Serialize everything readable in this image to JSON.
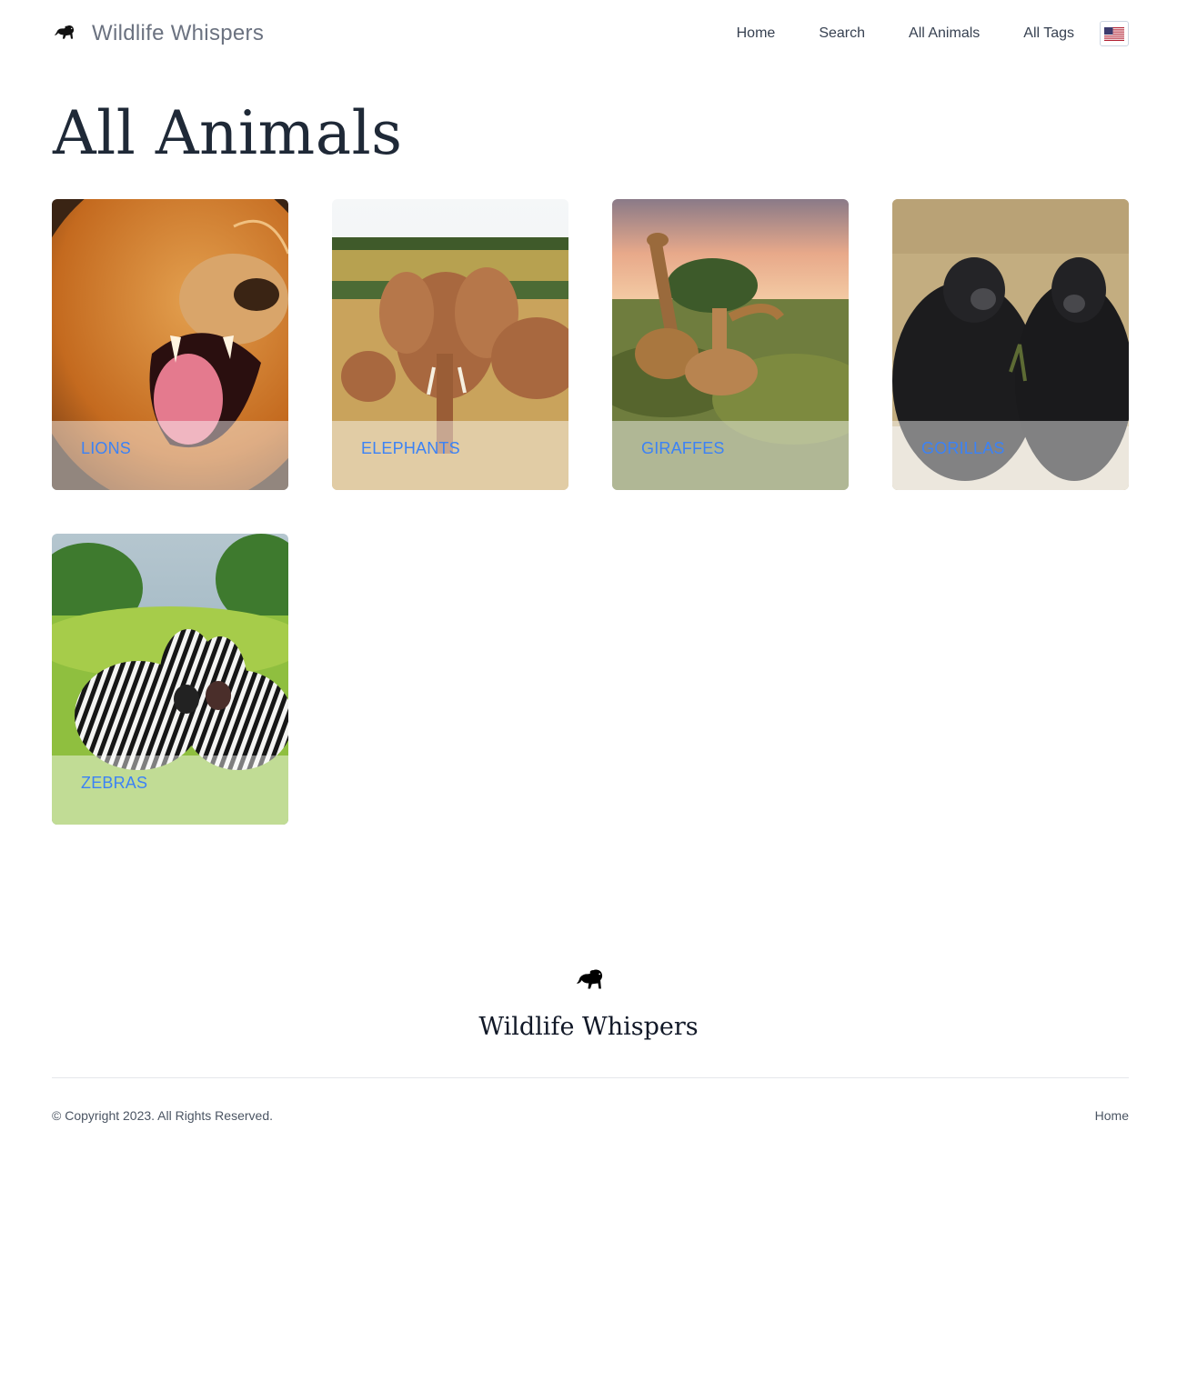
{
  "header": {
    "brand_name": "Wildlife Whispers",
    "nav": [
      "Home",
      "Search",
      "All Animals",
      "All Tags"
    ],
    "language_icon": "us-flag-icon"
  },
  "main": {
    "title": "All Animals",
    "animals": [
      {
        "label": "LIONS",
        "image": "lion-photo"
      },
      {
        "label": "ELEPHANTS",
        "image": "elephant-photo"
      },
      {
        "label": "GIRAFFES",
        "image": "giraffe-photo"
      },
      {
        "label": "GORILLAS",
        "image": "gorilla-photo"
      },
      {
        "label": "ZEBRAS",
        "image": "zebra-photo"
      }
    ]
  },
  "footer": {
    "brand_name": "Wildlife Whispers",
    "copyright": "© Copyright 2023. All Rights Reserved.",
    "home_link": "Home"
  },
  "colors": {
    "link_blue": "#3b82f6",
    "brand_gray": "#6b7280",
    "heading": "#1f2937"
  }
}
